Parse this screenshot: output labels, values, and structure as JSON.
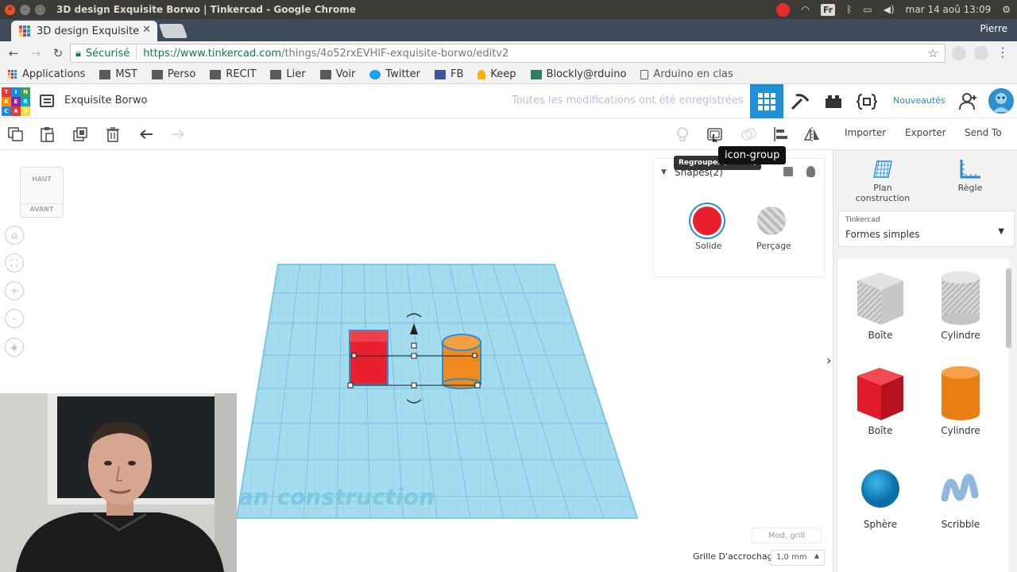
{
  "os": {
    "window_title": "3D design Exquisite Borwo | Tinkercad - Google Chrome",
    "clock": "mar 14 aoû 13:09",
    "fr_badge": "Fr"
  },
  "browser": {
    "tab_title": "3D design Exquisite",
    "user_name": "Pierre",
    "secure_label": "Sécurisé",
    "url_host": "https://www.tinkercad.com",
    "url_path": "/things/4o52rxEVHlF-exquisite-borwo/editv2",
    "bookmarks": [
      "Applications",
      "MST",
      "Perso",
      "RECIT",
      "Lier",
      "Voir",
      "Twitter",
      "FB",
      "Keep",
      "Blockly@rduino",
      "Arduino en clas"
    ]
  },
  "app": {
    "logo_letters": [
      "T",
      "I",
      "N",
      "K",
      "E",
      "R",
      "C",
      "A",
      "D"
    ],
    "design_name": "Exquisite Borwo",
    "save_status": "Toutes les modifications ont été enregistrées",
    "nouveautes": "Nouveautés"
  },
  "toolbar": {
    "import_label": "Importer",
    "export_label": "Exporter",
    "sendto_label": "Send To",
    "tooltip_small": "Regrouper (Ctrl+G)",
    "tooltip_big": "icon-group"
  },
  "viewcube": {
    "top": "HAUT",
    "front": "AVANT"
  },
  "inspector": {
    "title": "Shapes(2)",
    "solid_label": "Solide",
    "hole_label": "Perçage"
  },
  "workplane": {
    "label": "an construction"
  },
  "right_panel": {
    "workplane_label": "Plan construction",
    "ruler_label": "Règle",
    "library_small": "Tinkercad",
    "library_name": "Formes simples",
    "shapes": [
      {
        "name": "Boîte",
        "kind": "box-hole"
      },
      {
        "name": "Cylindre",
        "kind": "cyl-hole"
      },
      {
        "name": "Boîte",
        "kind": "box-red"
      },
      {
        "name": "Cylindre",
        "kind": "cyl-orange"
      },
      {
        "name": "Sphère",
        "kind": "sphere"
      },
      {
        "name": "Scribble",
        "kind": "scribble"
      }
    ]
  },
  "footer": {
    "mod_grill": "Mod. grill",
    "snap_label": "Grille D'accrochage",
    "snap_value": "1,0 mm"
  },
  "colors": {
    "accent": "#1e90d6",
    "solid_red": "#e8202e",
    "shape_orange": "#ef8a1e",
    "workplane_blue": "#a6dcef"
  }
}
